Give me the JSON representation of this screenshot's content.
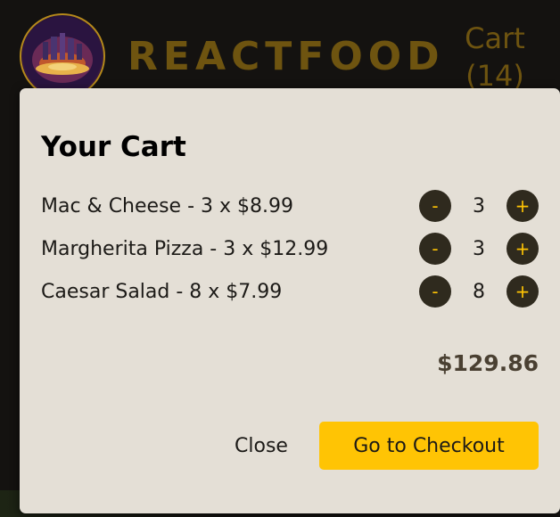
{
  "header": {
    "brand": "REACTFOOD",
    "cart_link_label": "Cart",
    "cart_link_count": "(14)"
  },
  "cart": {
    "title": "Your Cart",
    "items": [
      {
        "text": "Mac & Cheese - 3 x $8.99",
        "name": "Mac & Cheese",
        "quantity": 3,
        "price": "$8.99",
        "qty_label": "3"
      },
      {
        "text": "Margherita Pizza - 3 x $12.99",
        "name": "Margherita Pizza",
        "quantity": 3,
        "price": "$12.99",
        "qty_label": "3"
      },
      {
        "text": "Caesar Salad - 8 x $7.99",
        "name": "Caesar Salad",
        "quantity": 8,
        "price": "$7.99",
        "qty_label": "8"
      }
    ],
    "minus_label": "-",
    "plus_label": "+",
    "total": "$129.86"
  },
  "actions": {
    "close_label": "Close",
    "checkout_label": "Go to Checkout"
  },
  "colors": {
    "accent": "#ffc404",
    "modal_background": "#e4dfd6",
    "quantity_button": "#2f2a1e",
    "page_background": "#141210",
    "brand_text": "#6e5410"
  },
  "icons": {
    "logo": "restaurant-logo-icon"
  }
}
